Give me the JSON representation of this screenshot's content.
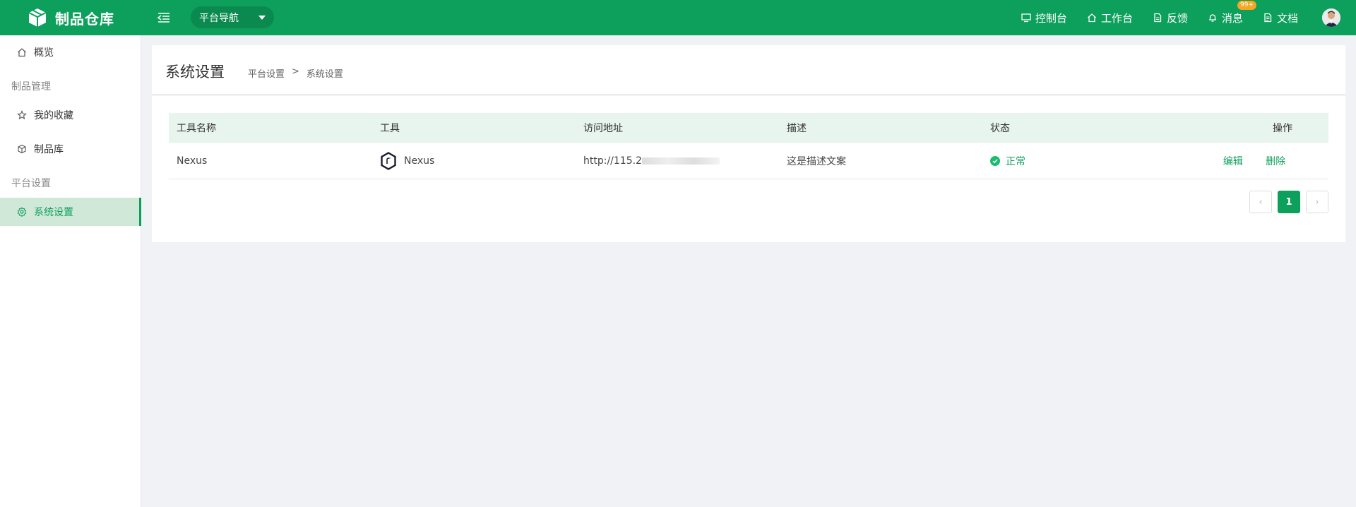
{
  "app": {
    "title": "制品仓库"
  },
  "topbar": {
    "nav_select": "平台导航",
    "items": [
      {
        "label": "控制台",
        "icon": "monitor-icon"
      },
      {
        "label": "工作台",
        "icon": "home-icon"
      },
      {
        "label": "反馈",
        "icon": "file-icon"
      },
      {
        "label": "消息",
        "icon": "bell-icon"
      },
      {
        "label": "文档",
        "icon": "doc-icon"
      }
    ],
    "message_badge": "99+"
  },
  "sidebar": {
    "overview": "概览",
    "group_artifacts": "制品管理",
    "favorites": "我的收藏",
    "artifact_lib": "制品库",
    "group_platform": "平台设置",
    "system_settings": "系统设置"
  },
  "page": {
    "title": "系统设置",
    "breadcrumb": [
      "平台设置",
      ">",
      "系统设置"
    ]
  },
  "table": {
    "headers": [
      "工具名称",
      "工具",
      "访问地址",
      "描述",
      "状态",
      "操作"
    ],
    "rows": [
      {
        "name": "Nexus",
        "tool": "Nexus",
        "url": "http://115.2",
        "desc": "这是描述文案",
        "status": "正常",
        "edit": "编辑",
        "delete": "删除"
      }
    ]
  },
  "pagination": {
    "current": "1",
    "prev": "‹",
    "next": "›"
  },
  "colors": {
    "primary": "#0d9f5c",
    "header_bg": "#e8f4ee",
    "active_side": "#cfe8d8"
  }
}
